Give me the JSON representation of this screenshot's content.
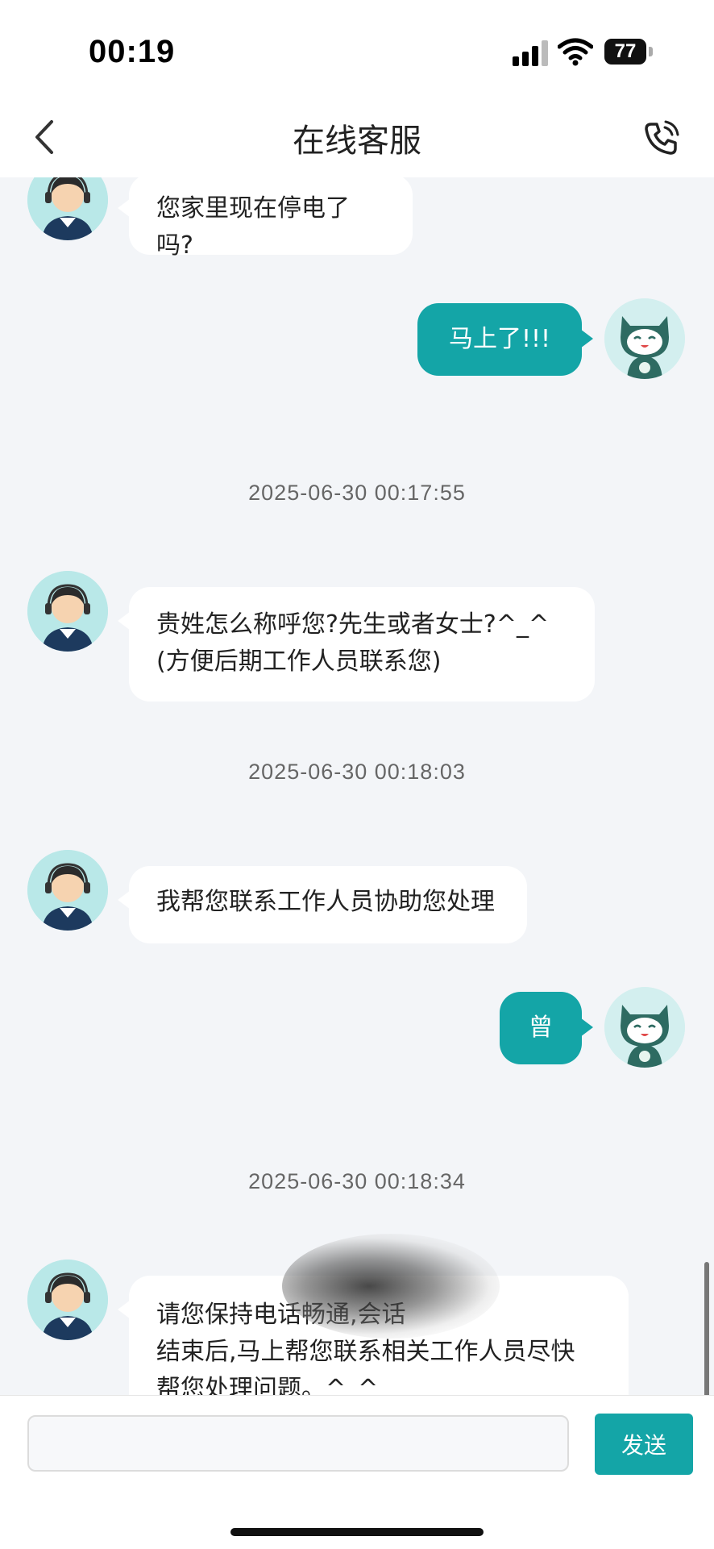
{
  "status_bar": {
    "time": "00:19",
    "battery": "77"
  },
  "header": {
    "title": "在线客服"
  },
  "messages": [
    {
      "from": "agent",
      "text": "您家里现在停电了吗?"
    },
    {
      "from": "user",
      "text": "马上了!!!"
    },
    {
      "timestamp": "2025-06-30 00:17:55"
    },
    {
      "from": "agent",
      "lines": [
        "贵姓怎么称呼您?先生或者女士?^_^",
        "(方便后期工作人员联系您)"
      ]
    },
    {
      "timestamp": "2025-06-30 00:18:03"
    },
    {
      "from": "agent",
      "text": "我帮您联系工作人员协助您处理"
    },
    {
      "from": "user",
      "text": "曾"
    },
    {
      "timestamp": "2025-06-30 00:18:34"
    },
    {
      "from": "agent",
      "lines": [
        "请您保持电话畅通,会话",
        "结束后,马上帮您联系相关工作人员尽快",
        "帮您处理问题。^_^"
      ]
    }
  ],
  "composer": {
    "input_value": "",
    "send_label": "发送"
  },
  "colors": {
    "accent": "#14a5a7",
    "background": "#f3f5f8"
  }
}
